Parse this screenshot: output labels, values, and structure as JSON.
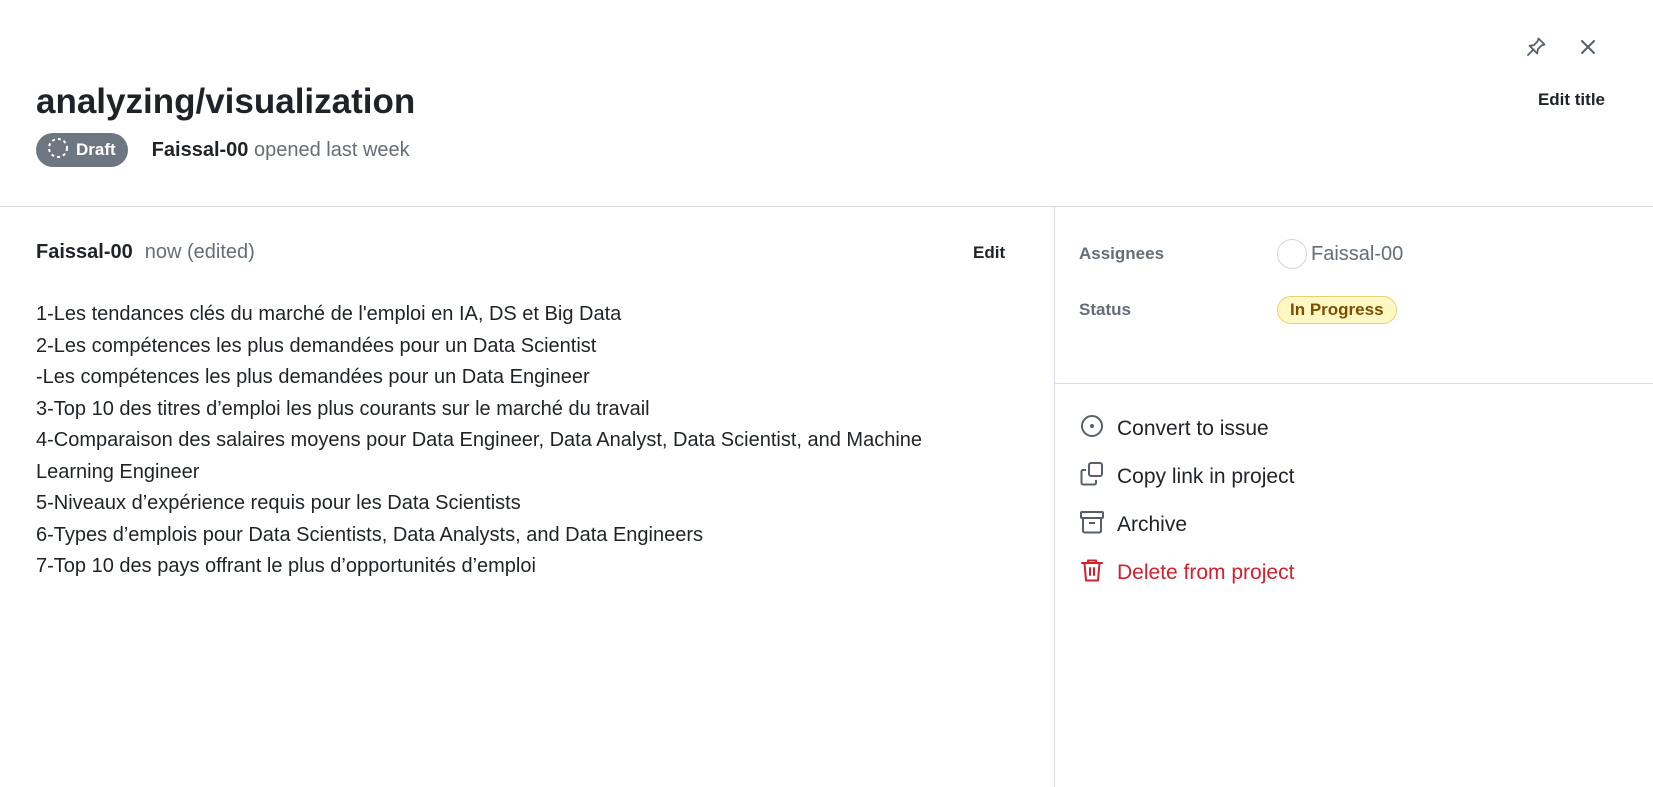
{
  "header": {
    "title": "analyzing/visualization",
    "edit_title_label": "Edit title",
    "draft_label": "Draft",
    "author": "Faissal-00",
    "opened_text": "opened last week",
    "pin_icon": "pin-icon",
    "close_icon": "close-icon"
  },
  "comment": {
    "author": "Faissal-00",
    "time": "now (edited)",
    "edit_label": "Edit",
    "lines": [
      "1-Les tendances clés du marché de l'emploi en IA, DS et Big Data",
      "2-Les compétences les plus demandées pour un Data Scientist",
      "-Les compétences les plus demandées pour un Data Engineer",
      "3-Top 10 des titres d’emploi les plus courants sur le marché du travail",
      "4-Comparaison des salaires moyens pour Data Engineer, Data Analyst, Data Scientist, and Machine Learning Engineer",
      "5-Niveaux d’expérience requis pour les Data Scientists",
      "6-Types d’emplois pour Data Scientists, Data Analysts, and Data Engineers",
      "7-Top 10 des pays offrant le plus d’opportunités d’emploi"
    ]
  },
  "sidebar": {
    "assignees_label": "Assignees",
    "assignee_name": "Faissal-00",
    "status_label": "Status",
    "status_value": "In Progress",
    "status_color": "#fff8c5",
    "actions": [
      {
        "label": "Convert to issue",
        "icon": "issue-opened-icon"
      },
      {
        "label": "Copy link in project",
        "icon": "copy-icon"
      },
      {
        "label": "Archive",
        "icon": "archive-icon"
      },
      {
        "label": "Delete from project",
        "icon": "trash-icon",
        "danger_color": "#cf222e"
      }
    ]
  }
}
